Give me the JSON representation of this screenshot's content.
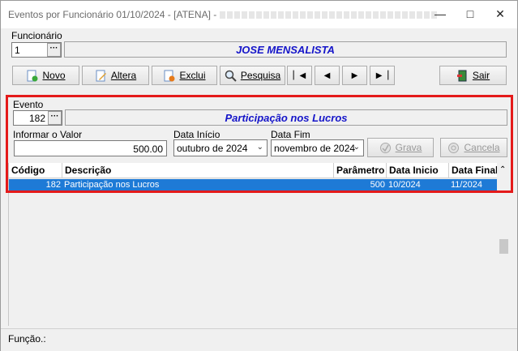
{
  "window": {
    "title": "Eventos por Funcionário 01/10/2024 - [ATENA] -"
  },
  "funcionario": {
    "label": "Funcionário",
    "code": "1",
    "name": "JOSE MENSALISTA"
  },
  "toolbar": {
    "novo": "Novo",
    "altera": "Altera",
    "exclui": "Exclui",
    "pesquisa": "Pesquisa",
    "sair": "Sair"
  },
  "evento": {
    "label": "Evento",
    "code": "182",
    "name": "Participação nos Lucros"
  },
  "form": {
    "valor_label": "Informar o Valor",
    "valor": "500.00",
    "inicio_label": "Data Início",
    "inicio": "outubro de 2024",
    "fim_label": "Data Fim",
    "fim": "novembro de 2024",
    "grava": "Grava",
    "cancela": "Cancela"
  },
  "grid": {
    "columns": [
      "Código",
      "Descrição",
      "Parâmetro",
      "Data Inicio",
      "Data Final"
    ],
    "rows": [
      {
        "codigo": "182",
        "descricao": "Participação nos Lucros",
        "parametro": "500",
        "inicio": "10/2024",
        "final": "11/2024"
      }
    ]
  },
  "status": {
    "funcao": "Função.:"
  },
  "colors": {
    "accent": "#1e7ad6",
    "title_blue": "#1515c9",
    "highlight": "#e41a1a"
  }
}
